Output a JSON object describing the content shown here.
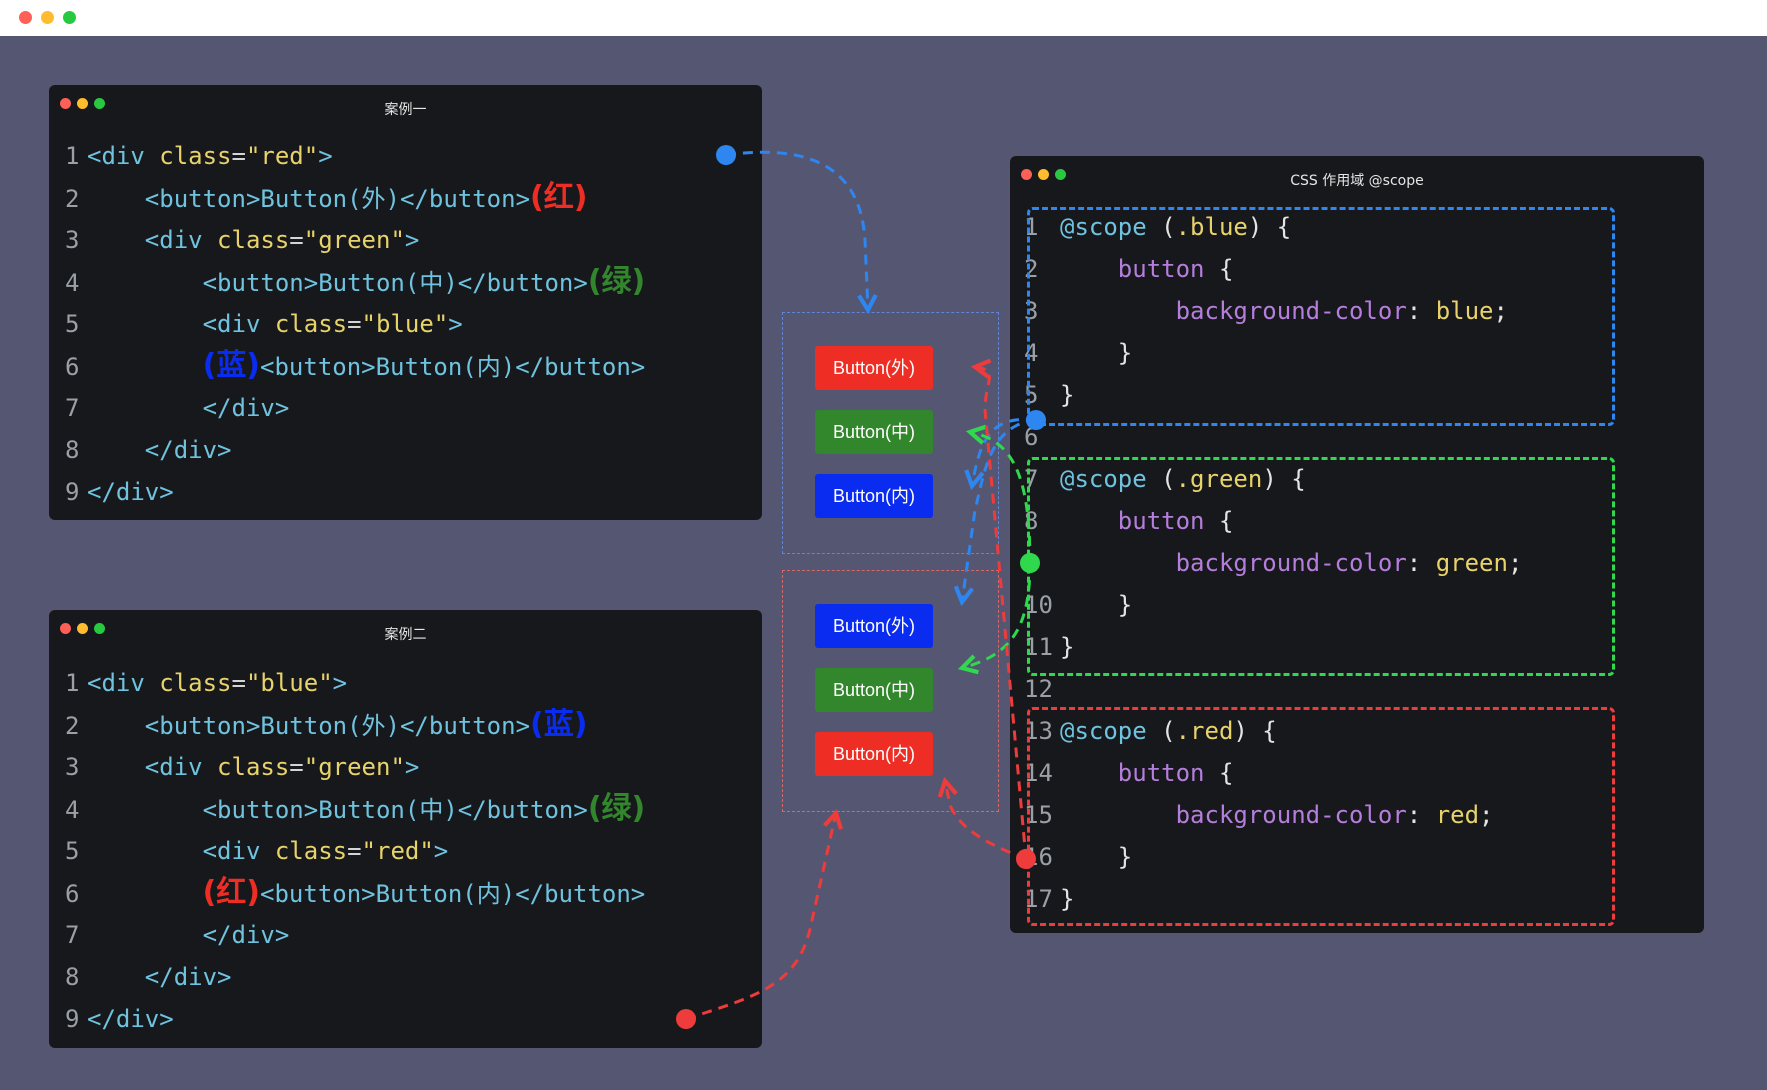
{
  "colors": {
    "red": "#ee2e24",
    "green": "#32862c",
    "blue": "#0a2bf0",
    "line_blue": "#2e86f0",
    "line_green": "#2fd84d",
    "line_red": "#ee3c3c"
  },
  "case1": {
    "title": "案例一",
    "lines": [
      {
        "n": "1",
        "parts": [
          [
            "tag",
            "<div "
          ],
          [
            "attr",
            "class"
          ],
          [
            "op",
            "="
          ],
          [
            "str",
            "\"red\""
          ],
          [
            "tag",
            ">"
          ]
        ]
      },
      {
        "n": "2",
        "parts": [
          [
            "tag",
            "    <button>"
          ],
          [
            "txt",
            "Button(外)"
          ],
          [
            "tag",
            "</button>"
          ]
        ],
        "note": "(红)",
        "note_color": "red"
      },
      {
        "n": "3",
        "parts": [
          [
            "tag",
            "    <div "
          ],
          [
            "attr",
            "class"
          ],
          [
            "op",
            "="
          ],
          [
            "str",
            "\"green\""
          ],
          [
            "tag",
            ">"
          ]
        ]
      },
      {
        "n": "4",
        "parts": [
          [
            "tag",
            "        <button>"
          ],
          [
            "txt",
            "Button(中)"
          ],
          [
            "tag",
            "</button>"
          ]
        ],
        "note": "(绿)",
        "note_color": "green"
      },
      {
        "n": "5",
        "parts": [
          [
            "tag",
            "        <div "
          ],
          [
            "attr",
            "class"
          ],
          [
            "op",
            "="
          ],
          [
            "str",
            "\"blue\""
          ],
          [
            "tag",
            ">"
          ]
        ]
      },
      {
        "n": "6",
        "prenote": "(蓝)",
        "prenote_color": "blue",
        "parts": [
          [
            "tag",
            "<button>"
          ],
          [
            "txt",
            "Button(内)"
          ],
          [
            "tag",
            "</button>"
          ]
        ]
      },
      {
        "n": "7",
        "parts": [
          [
            "tag",
            "        </div>"
          ]
        ]
      },
      {
        "n": "8",
        "parts": [
          [
            "tag",
            "    </div>"
          ]
        ]
      },
      {
        "n": "9",
        "parts": [
          [
            "tag",
            "</div>"
          ]
        ]
      }
    ]
  },
  "case2": {
    "title": "案例二",
    "lines": [
      {
        "n": "1",
        "parts": [
          [
            "tag",
            "<div "
          ],
          [
            "attr",
            "class"
          ],
          [
            "op",
            "="
          ],
          [
            "str",
            "\"blue\""
          ],
          [
            "tag",
            ">"
          ]
        ]
      },
      {
        "n": "2",
        "parts": [
          [
            "tag",
            "    <button>"
          ],
          [
            "txt",
            "Button(外)"
          ],
          [
            "tag",
            "</button>"
          ]
        ],
        "note": "(蓝)",
        "note_color": "blue"
      },
      {
        "n": "3",
        "parts": [
          [
            "tag",
            "    <div "
          ],
          [
            "attr",
            "class"
          ],
          [
            "op",
            "="
          ],
          [
            "str",
            "\"green\""
          ],
          [
            "tag",
            ">"
          ]
        ]
      },
      {
        "n": "4",
        "parts": [
          [
            "tag",
            "        <button>"
          ],
          [
            "txt",
            "Button(中)"
          ],
          [
            "tag",
            "</button>"
          ]
        ],
        "note": "(绿)",
        "note_color": "green"
      },
      {
        "n": "5",
        "parts": [
          [
            "tag",
            "        <div "
          ],
          [
            "attr",
            "class"
          ],
          [
            "op",
            "="
          ],
          [
            "str",
            "\"red\""
          ],
          [
            "tag",
            ">"
          ]
        ]
      },
      {
        "n": "6",
        "prenote": "(红)",
        "prenote_color": "red",
        "parts": [
          [
            "tag",
            "<button>"
          ],
          [
            "txt",
            "Button(内)"
          ],
          [
            "tag",
            "</button>"
          ]
        ]
      },
      {
        "n": "7",
        "parts": [
          [
            "tag",
            "        </div>"
          ]
        ]
      },
      {
        "n": "8",
        "parts": [
          [
            "tag",
            "    </div>"
          ]
        ]
      },
      {
        "n": "9",
        "parts": [
          [
            "tag",
            "</div>"
          ]
        ]
      }
    ]
  },
  "css_window": {
    "title": "CSS 作用域 @scope",
    "lines": [
      {
        "n": "1",
        "parts": [
          [
            "scope",
            "@scope "
          ],
          [
            "punc",
            "("
          ],
          [
            "sel",
            ".blue"
          ],
          [
            "punc",
            ") {"
          ]
        ]
      },
      {
        "n": "2",
        "parts": [
          [
            "kw",
            "    button "
          ],
          [
            "punc",
            "{"
          ]
        ]
      },
      {
        "n": "3",
        "parts": [
          [
            "kw",
            "        background-color"
          ],
          [
            "punc",
            ": "
          ],
          [
            "val",
            "blue"
          ],
          [
            "punc",
            ";"
          ]
        ]
      },
      {
        "n": "4",
        "parts": [
          [
            "punc",
            "    }"
          ]
        ]
      },
      {
        "n": "5",
        "parts": [
          [
            "punc",
            "}"
          ]
        ]
      },
      {
        "n": "6",
        "parts": []
      },
      {
        "n": "7",
        "parts": [
          [
            "scope",
            "@scope "
          ],
          [
            "punc",
            "("
          ],
          [
            "sel",
            ".green"
          ],
          [
            "punc",
            ") {"
          ]
        ]
      },
      {
        "n": "8",
        "parts": [
          [
            "kw",
            "    button "
          ],
          [
            "punc",
            "{"
          ]
        ]
      },
      {
        "n": "9",
        "parts": [
          [
            "kw",
            "        background-color"
          ],
          [
            "punc",
            ": "
          ],
          [
            "val",
            "green"
          ],
          [
            "punc",
            ";"
          ]
        ]
      },
      {
        "n": "10",
        "parts": [
          [
            "punc",
            "    }"
          ]
        ]
      },
      {
        "n": "11",
        "parts": [
          [
            "punc",
            "}"
          ]
        ]
      },
      {
        "n": "12",
        "parts": []
      },
      {
        "n": "13",
        "parts": [
          [
            "scope",
            "@scope "
          ],
          [
            "punc",
            "("
          ],
          [
            "sel",
            ".red"
          ],
          [
            "punc",
            ") {"
          ]
        ]
      },
      {
        "n": "14",
        "parts": [
          [
            "kw",
            "    button "
          ],
          [
            "punc",
            "{"
          ]
        ]
      },
      {
        "n": "15",
        "parts": [
          [
            "kw",
            "        background-color"
          ],
          [
            "punc",
            ": "
          ],
          [
            "val",
            "red"
          ],
          [
            "punc",
            ";"
          ]
        ]
      },
      {
        "n": "16",
        "parts": [
          [
            "punc",
            "    }"
          ]
        ]
      },
      {
        "n": "17",
        "parts": [
          [
            "punc",
            "}"
          ]
        ]
      }
    ]
  },
  "preview": {
    "case1_buttons": [
      {
        "label": "Button(外)",
        "color": "red"
      },
      {
        "label": "Button(中)",
        "color": "green"
      },
      {
        "label": "Button(内)",
        "color": "blue"
      }
    ],
    "case2_buttons": [
      {
        "label": "Button(外)",
        "color": "blue"
      },
      {
        "label": "Button(中)",
        "color": "green"
      },
      {
        "label": "Button(内)",
        "color": "red"
      }
    ]
  }
}
